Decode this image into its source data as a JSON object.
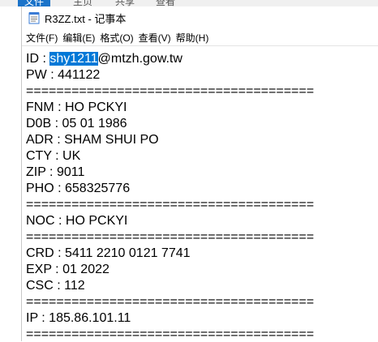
{
  "background_window": {
    "tabs": [
      "文件",
      "主页",
      "共享",
      "查看"
    ]
  },
  "window": {
    "title": "R3ZZ.txt - 记事本",
    "icon": "notepad-icon"
  },
  "menu": {
    "items": [
      "文件(F)",
      "编辑(E)",
      "格式(O)",
      "查看(V)",
      "帮助(H)"
    ]
  },
  "content": {
    "id_prefix": "ID : ",
    "id_selected": "shy1211",
    "id_suffix": "@mtzh.gow.tw",
    "lines": [
      "PW : 441122",
      "======================================",
      "FNM : HO PCKYI",
      "D0B : 05 01 1986",
      "ADR : SHAM SHUI PO",
      "CTY : UK",
      "ZIP : 9011",
      "PHO : 658325776",
      "======================================",
      "NOC : HO PCKYI",
      "======================================",
      "CRD : 5411 2210 0121 7741",
      "EXP : 01 2022",
      "CSC : 112",
      "======================================",
      "IP : 185.86.101.11",
      "======================================"
    ]
  },
  "colors": {
    "selection": "#0078d7",
    "text": "#000000"
  }
}
